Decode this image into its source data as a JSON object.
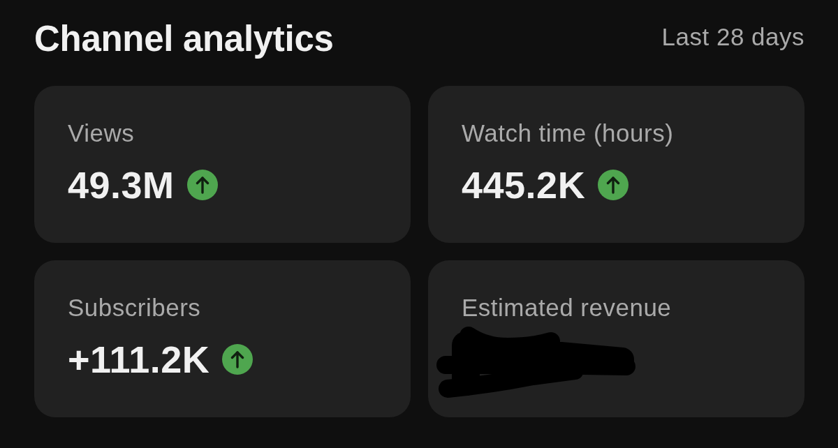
{
  "header": {
    "title": "Channel analytics",
    "period": "Last 28 days"
  },
  "metrics": [
    {
      "kind": "rising",
      "label": "Views",
      "value": "49.3M"
    },
    {
      "kind": "rising",
      "label": "Watch time (hours)",
      "value": "445.2K"
    },
    {
      "kind": "rising",
      "label": "Subscribers",
      "value": "+111.2K"
    },
    {
      "kind": "redacted",
      "label": "Estimated revenue"
    }
  ]
}
